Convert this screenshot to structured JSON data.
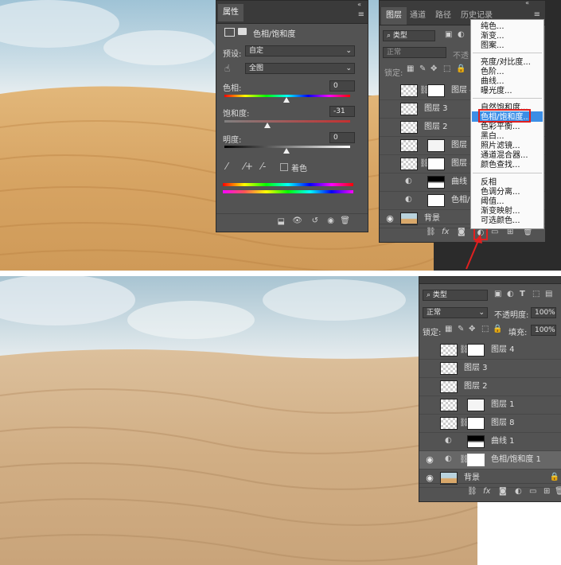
{
  "top": {
    "properties_panel": {
      "tab": "属性",
      "adjustment_title": "色相/饱和度",
      "preset_label": "预设:",
      "preset_value": "自定",
      "channel_value": "全图",
      "hue_label": "色相:",
      "hue_value": "0",
      "saturation_label": "饱和度:",
      "saturation_value": "-31",
      "lightness_label": "明度:",
      "lightness_value": "0",
      "colorize_label": "着色"
    },
    "layers_panel": {
      "tabs": [
        "图层",
        "通道",
        "路径",
        "历史记录"
      ],
      "filter_label": "类型",
      "blend_mode": "正常",
      "opacity_prefix": "不透",
      "lock_label": "锁定:",
      "layers": [
        {
          "name": "图层 4"
        },
        {
          "name": "图层 3"
        },
        {
          "name": "图层 2"
        },
        {
          "name": "图层 1"
        },
        {
          "name": "图层 8"
        },
        {
          "name": "曲线 1"
        },
        {
          "name": "色相/饱"
        },
        {
          "name": "背景"
        }
      ]
    },
    "adjustment_menu": {
      "groups": [
        [
          "纯色...",
          "渐变...",
          "图案..."
        ],
        [
          "亮度/对比度...",
          "色阶...",
          "曲线...",
          "曝光度..."
        ],
        [
          "自然饱和度...",
          "色相/饱和度...",
          "色彩平衡...",
          "黑白...",
          "照片滤镜...",
          "通道混合器...",
          "颜色查找..."
        ],
        [
          "反相",
          "色调分离...",
          "阈值...",
          "渐变映射...",
          "可选颜色..."
        ]
      ],
      "highlighted": "色相/饱和度..."
    }
  },
  "bottom": {
    "layers_panel": {
      "filter_label": "类型",
      "blend_mode": "正常",
      "opacity_label": "不透明度:",
      "opacity_value": "100%",
      "lock_label": "锁定:",
      "fill_label": "填充:",
      "fill_value": "100%",
      "layers": [
        {
          "name": "图层 4",
          "visible": false
        },
        {
          "name": "图层 3",
          "visible": false
        },
        {
          "name": "图层 2",
          "visible": false
        },
        {
          "name": "图层 1",
          "visible": false
        },
        {
          "name": "图层 8",
          "visible": false
        },
        {
          "name": "曲线 1",
          "visible": false
        },
        {
          "name": "色相/饱和度 1",
          "visible": true
        },
        {
          "name": "背景",
          "visible": true
        }
      ]
    }
  },
  "colors": {
    "panel_bg": "#535353",
    "menu_highlight": "#3c8ee6",
    "callout_red": "#e02020"
  }
}
